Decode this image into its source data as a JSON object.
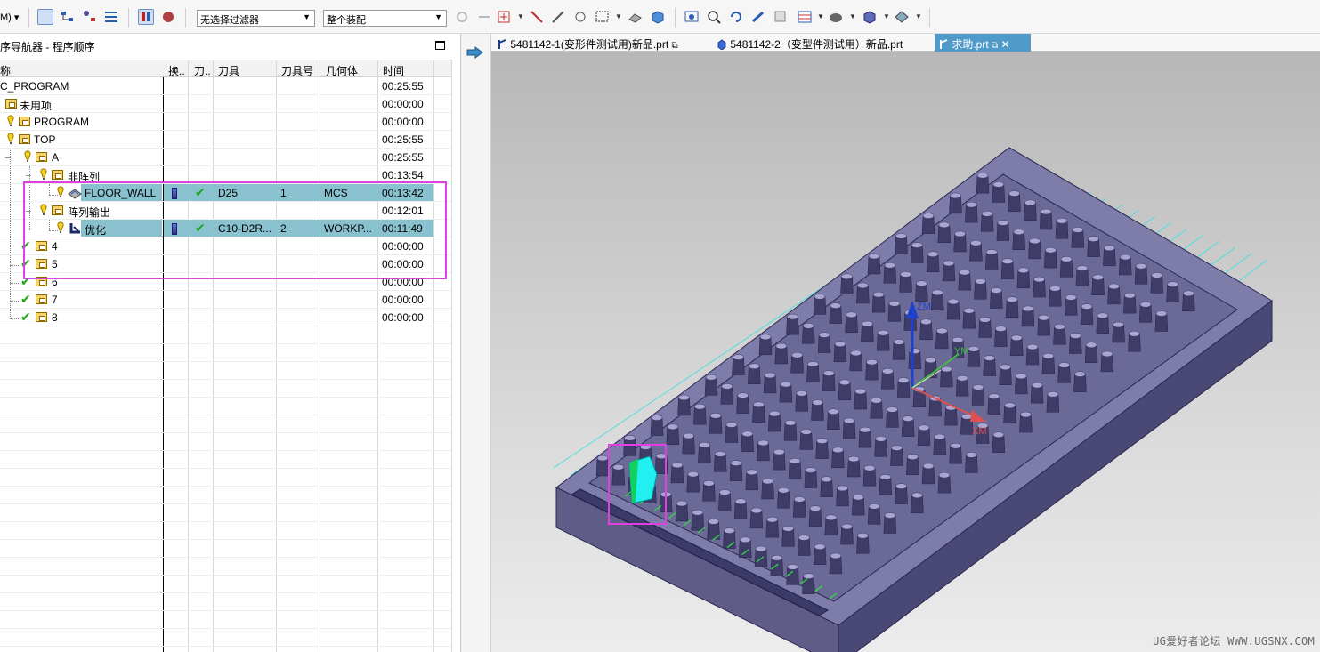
{
  "toolbar": {
    "menu_fragment": "M) ▾",
    "filter_value": "无选择过滤器",
    "assembly_value": "整个装配"
  },
  "navigator": {
    "title": "序导航器 - 程序顺序",
    "columns": [
      "称",
      "换..",
      "刀..",
      "刀具",
      "刀具号",
      "几何体",
      "时间"
    ],
    "rows": [
      {
        "name": "C_PROGRAM",
        "tool": "",
        "tool_no": "",
        "geometry": "",
        "time": "00:25:55"
      },
      {
        "name": "未用项",
        "tool": "",
        "tool_no": "",
        "geometry": "",
        "time": "00:00:00"
      },
      {
        "name": "PROGRAM",
        "tool": "",
        "tool_no": "",
        "geometry": "",
        "time": "00:00:00"
      },
      {
        "name": "TOP",
        "tool": "",
        "tool_no": "",
        "geometry": "",
        "time": "00:25:55"
      },
      {
        "name": "A",
        "tool": "",
        "tool_no": "",
        "geometry": "",
        "time": "00:25:55"
      },
      {
        "name": "非阵列",
        "tool": "",
        "tool_no": "",
        "geometry": "",
        "time": "00:13:54"
      },
      {
        "name": "FLOOR_WALL",
        "tool": "D25",
        "tool_no": "1",
        "geometry": "MCS",
        "time": "00:13:42"
      },
      {
        "name": "阵列输出",
        "tool": "",
        "tool_no": "",
        "geometry": "",
        "time": "00:12:01"
      },
      {
        "name": "优化",
        "tool": "C10-D2R...",
        "tool_no": "2",
        "geometry": "WORKP...",
        "time": "00:11:49"
      },
      {
        "name": "4",
        "tool": "",
        "tool_no": "",
        "geometry": "",
        "time": "00:00:00"
      },
      {
        "name": "5",
        "tool": "",
        "tool_no": "",
        "geometry": "",
        "time": "00:00:00"
      },
      {
        "name": "6",
        "tool": "",
        "tool_no": "",
        "geometry": "",
        "time": "00:00:00"
      },
      {
        "name": "7",
        "tool": "",
        "tool_no": "",
        "geometry": "",
        "time": "00:00:00"
      },
      {
        "name": "8",
        "tool": "",
        "tool_no": "",
        "geometry": "",
        "time": "00:00:00"
      }
    ]
  },
  "tabs": [
    {
      "label": "5481142-1(变形件测试用)新品.prt",
      "active": false
    },
    {
      "label": "5481142-2（变型件测试用）新品.prt",
      "active": false
    },
    {
      "label": "求助.prt",
      "active": true
    }
  ],
  "viewport": {
    "axis_x": "XM",
    "axis_y": "YM",
    "axis_z": "ZM",
    "watermark": "UG爱好者论坛 WWW.UGSNX.COM"
  },
  "colors": {
    "selection": "#89c1cf",
    "highlight_box": "#e040e0",
    "active_tab": "#4f9ac8",
    "part": "#6a6898",
    "toolpath": "#40e0e0"
  }
}
